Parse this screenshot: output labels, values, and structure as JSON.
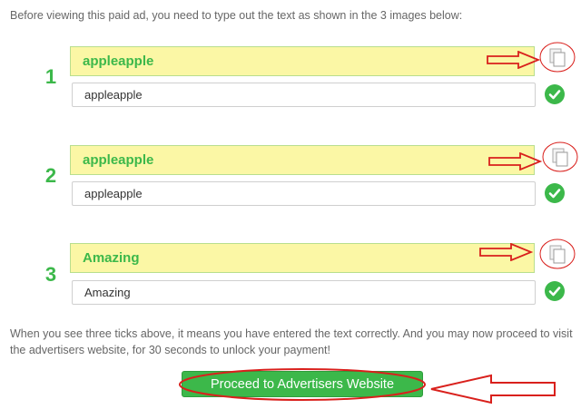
{
  "intro_text": "Before viewing this paid ad, you need to type out the text as shown in the 3 images below:",
  "rows": [
    {
      "number": "1",
      "captcha_text": "appleapple",
      "input_value": "appleapple",
      "verified": true
    },
    {
      "number": "2",
      "captcha_text": "appleapple",
      "input_value": "appleapple",
      "verified": true
    },
    {
      "number": "3",
      "captcha_text": "Amazing",
      "input_value": "Amazing",
      "verified": true
    }
  ],
  "footer_text": "When you see three ticks above, it means you have entered the text correctly. And you may now proceed to visit the advertisers website, for 30 seconds to unlock your payment!",
  "proceed_button_label": "Proceed to Advertisers Website",
  "colors": {
    "accent_green": "#3cb84a",
    "captcha_background": "#fbf7a5",
    "annotation_red": "#d9201c"
  },
  "icons": {
    "copy": "copy-document-icon",
    "tick": "checkmark-icon",
    "arrow": "red-arrow-annotation"
  }
}
